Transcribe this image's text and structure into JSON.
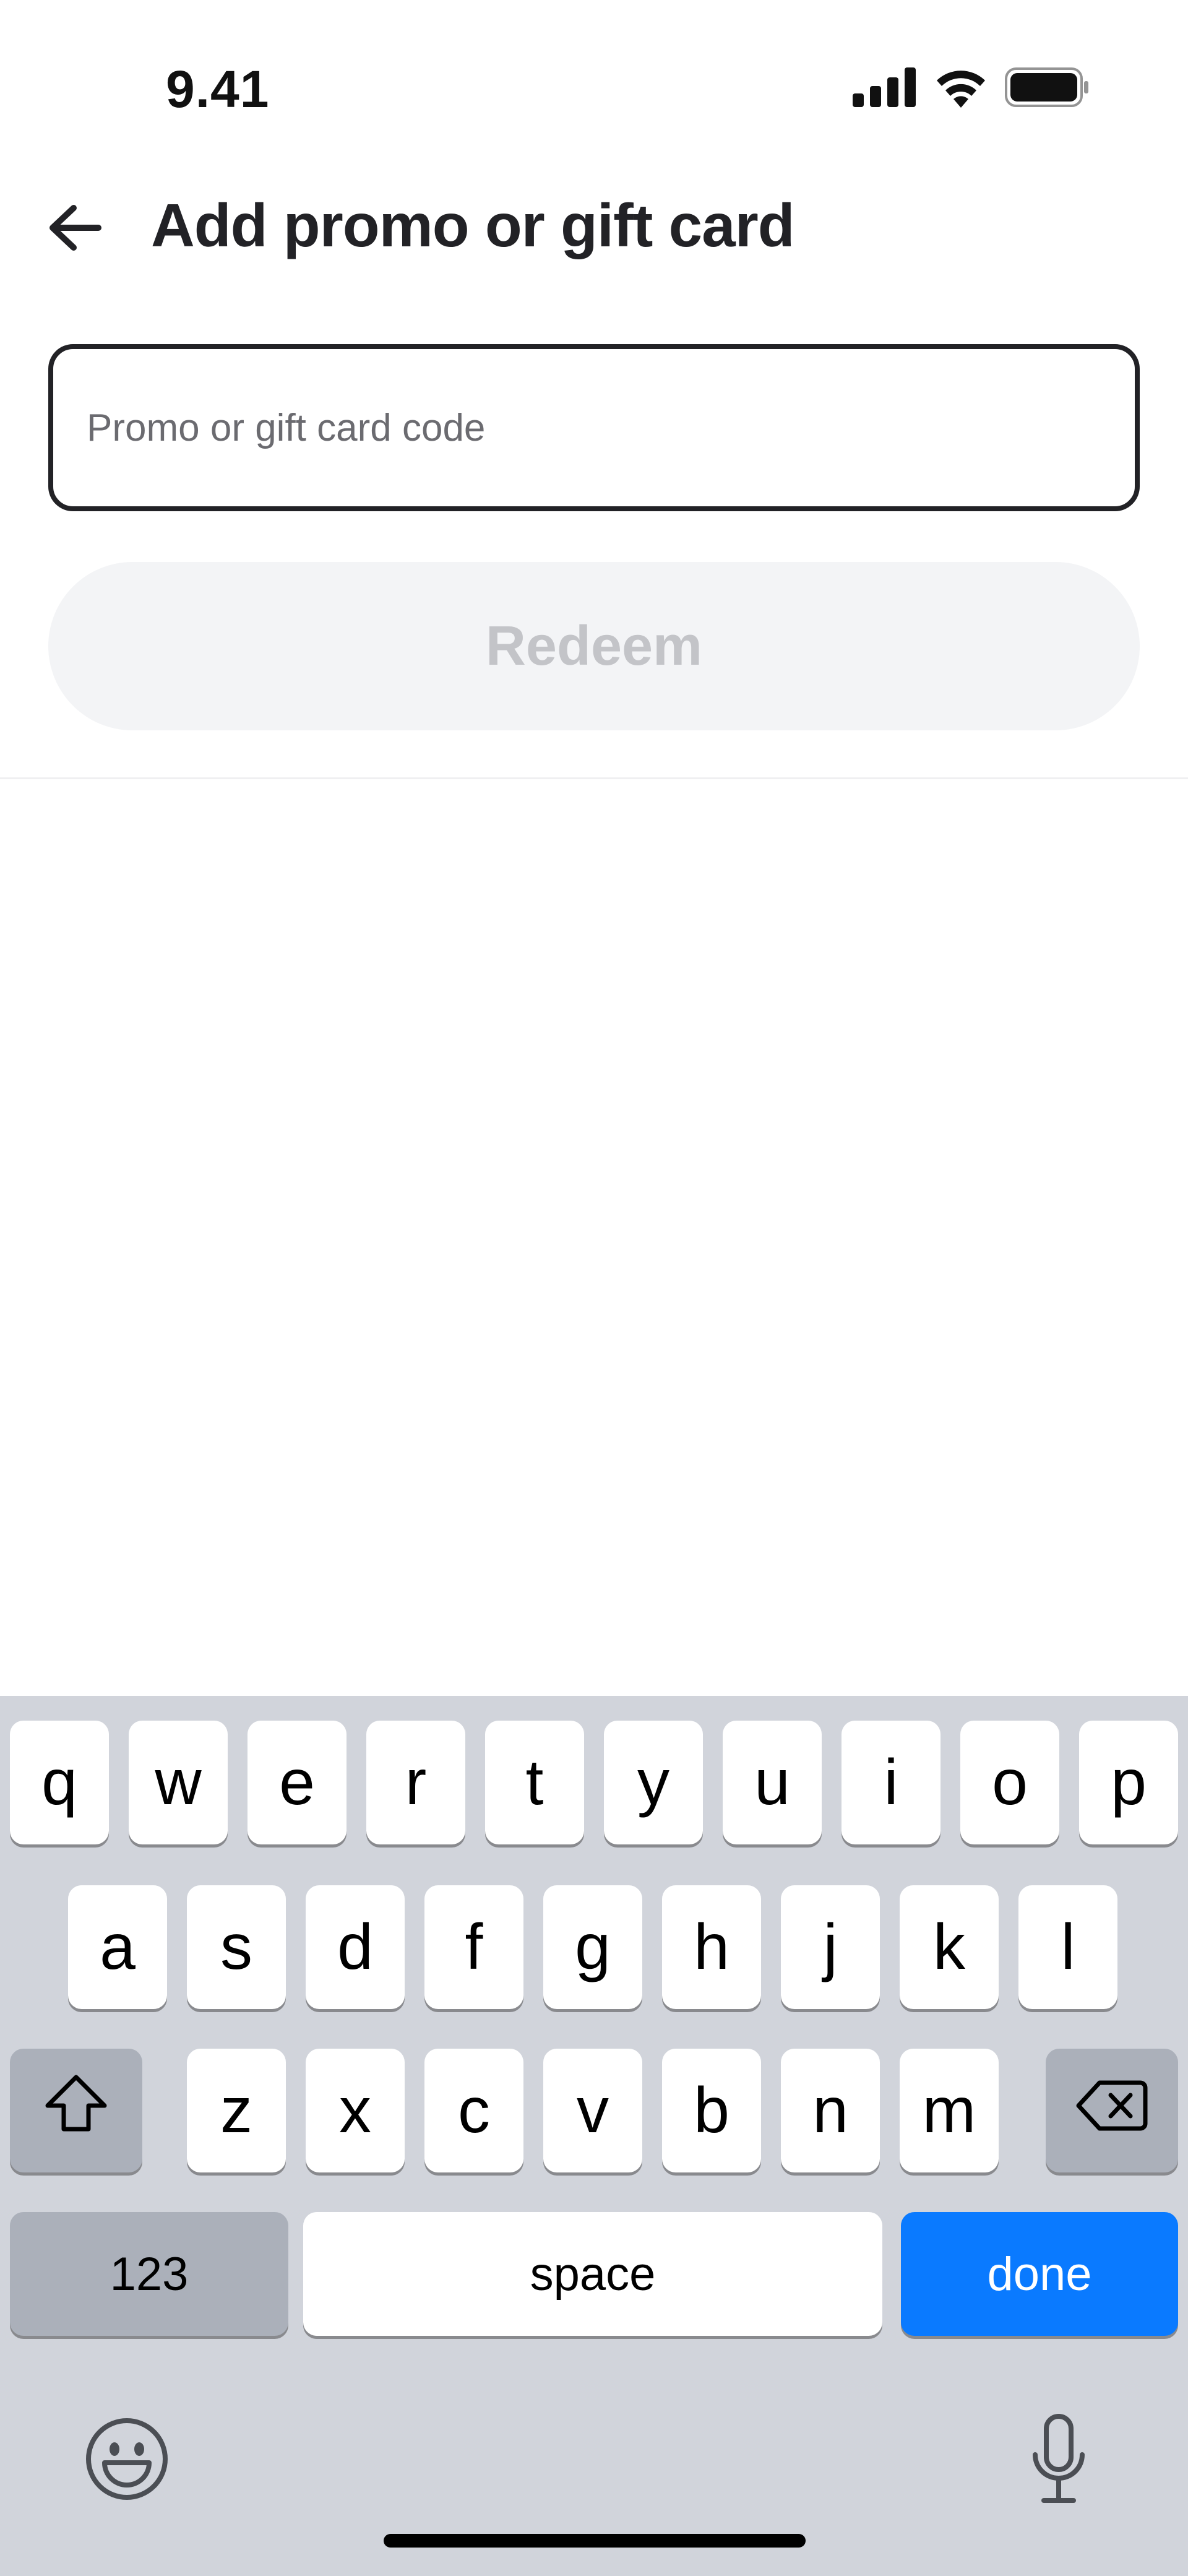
{
  "status_bar": {
    "time": "9.41",
    "icons": [
      "signal-icon",
      "wifi-icon",
      "battery-icon"
    ]
  },
  "header": {
    "back_icon": "arrow-left-icon",
    "title": "Add promo or gift card"
  },
  "form": {
    "code_input": {
      "value": "",
      "placeholder": "Promo or gift card code"
    },
    "redeem_label": "Redeem"
  },
  "keyboard": {
    "row1": [
      "q",
      "w",
      "e",
      "r",
      "t",
      "y",
      "u",
      "i",
      "o",
      "p"
    ],
    "row2": [
      "a",
      "s",
      "d",
      "f",
      "g",
      "h",
      "j",
      "k",
      "l"
    ],
    "row3": [
      "z",
      "x",
      "c",
      "v",
      "b",
      "n",
      "m"
    ],
    "shift_icon": "shift-icon",
    "backspace_icon": "backspace-icon",
    "numbers_label": "123",
    "space_label": "space",
    "done_label": "done",
    "emoji_icon": "emoji-icon",
    "mic_icon": "microphone-icon"
  },
  "colors": {
    "accent": "#0a7aff",
    "title": "#222226",
    "disabled_button_bg": "#f3f4f6",
    "disabled_button_text": "#c3c4c8",
    "keyboard_bg": "#d1d4db"
  }
}
